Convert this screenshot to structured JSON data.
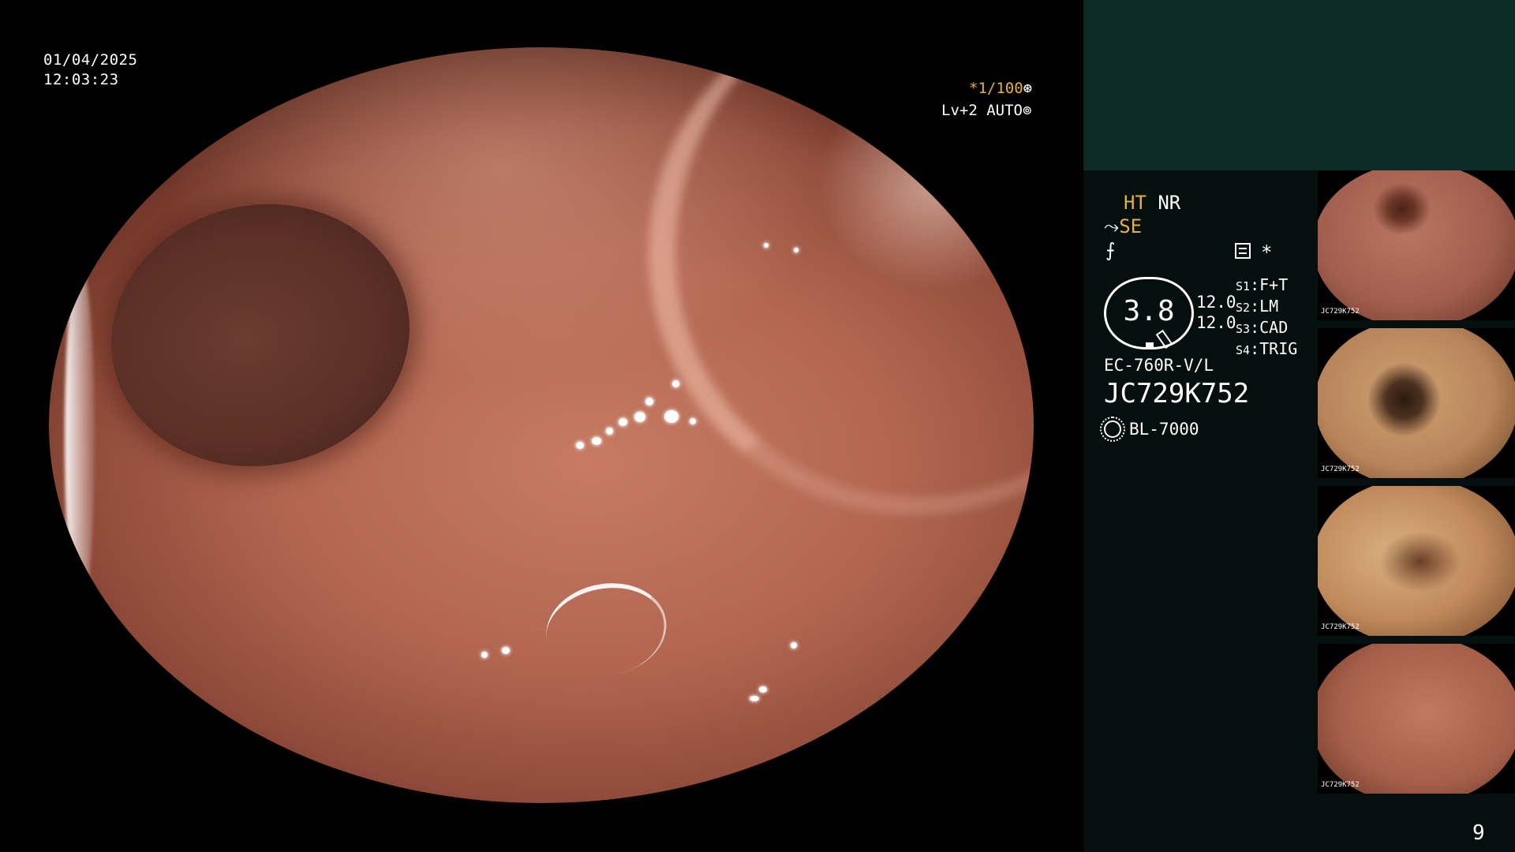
{
  "overlay": {
    "date": "01/04/2025",
    "time": "12:03:23",
    "shutter": "*1/100",
    "shutter_icon": "aperture-icon",
    "iris": "Lv+2 AUTO",
    "iris_icon": "iris-icon"
  },
  "status": {
    "ht": "HT",
    "nr": "NR",
    "se_symbol": "⤳",
    "se": "SE",
    "f_symbol": "⨍",
    "star": "*",
    "zoom_value": "3.8",
    "gain_1": "12.0",
    "gain_2": "12.0",
    "switches": [
      {
        "key": "S1",
        "value": "F+T"
      },
      {
        "key": "S2",
        "value": "LM"
      },
      {
        "key": "S3",
        "value": "CAD"
      },
      {
        "key": "S4",
        "value": "TRIG"
      }
    ],
    "scope_model": "EC-760R-V/L",
    "scope_serial": "JC729K752",
    "light_source": "BL-7000",
    "page_number": "9"
  },
  "thumbnails": [
    {
      "caption": "JC729K752"
    },
    {
      "caption": "JC729K752"
    },
    {
      "caption": "JC729K752"
    },
    {
      "caption": "JC729K752"
    }
  ],
  "colors": {
    "accent": "#e5b23a",
    "sidebar_top": "#0c2a26",
    "sidebar": "#050f0d"
  }
}
